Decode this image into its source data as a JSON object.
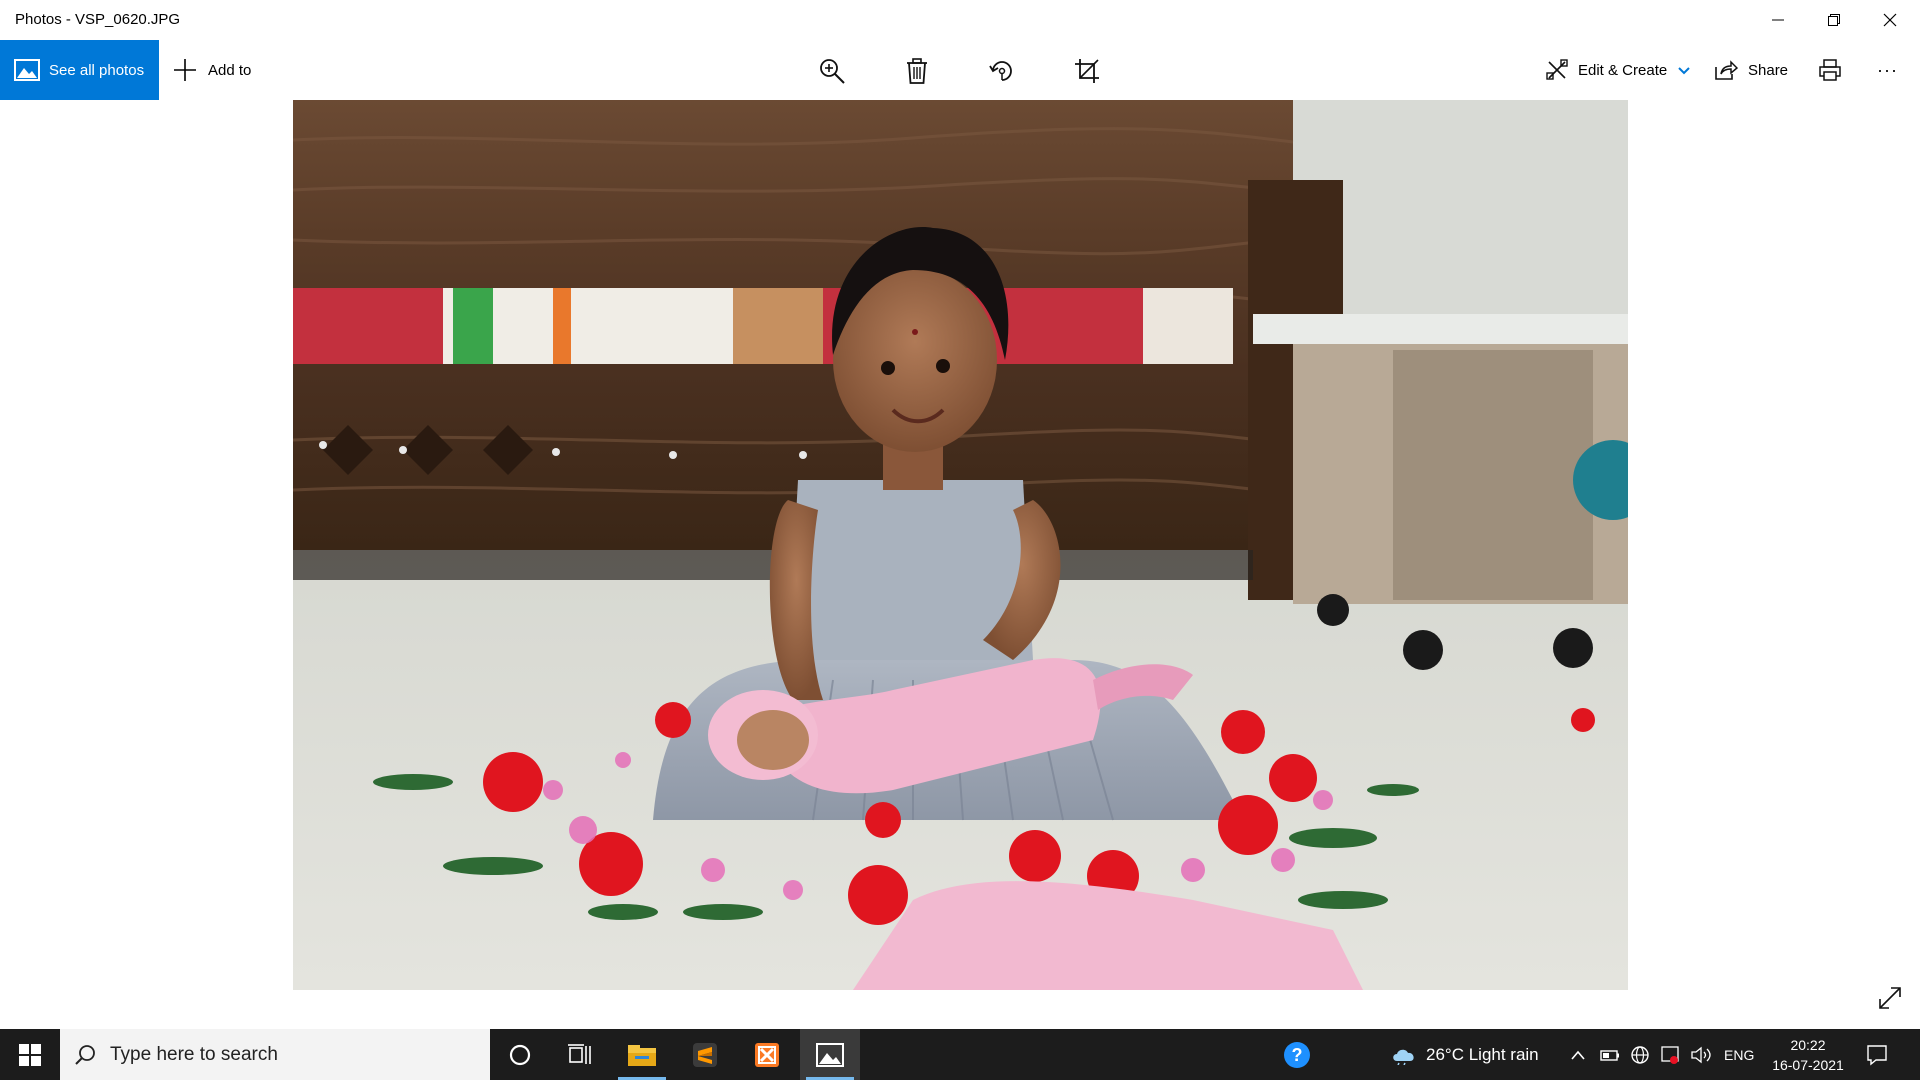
{
  "window": {
    "title": "Photos - VSP_0620.JPG"
  },
  "commandbar": {
    "see_all_label": "See all photos",
    "add_to_label": "Add to",
    "edit_create_label": "Edit & Create",
    "share_label": "Share",
    "more_label": "···"
  },
  "taskbar": {
    "search_placeholder": "Type here to search",
    "weather_text": "26°C  Light rain",
    "language": "ENG",
    "time": "20:22",
    "date": "16-07-2021"
  },
  "colors": {
    "accent": "#0078d7",
    "taskbar_bg": "#1c1c1c"
  },
  "icons": {
    "zoom": "zoom-in-icon",
    "delete": "trash-icon",
    "rotate": "rotate-icon",
    "crop": "crop-icon"
  }
}
